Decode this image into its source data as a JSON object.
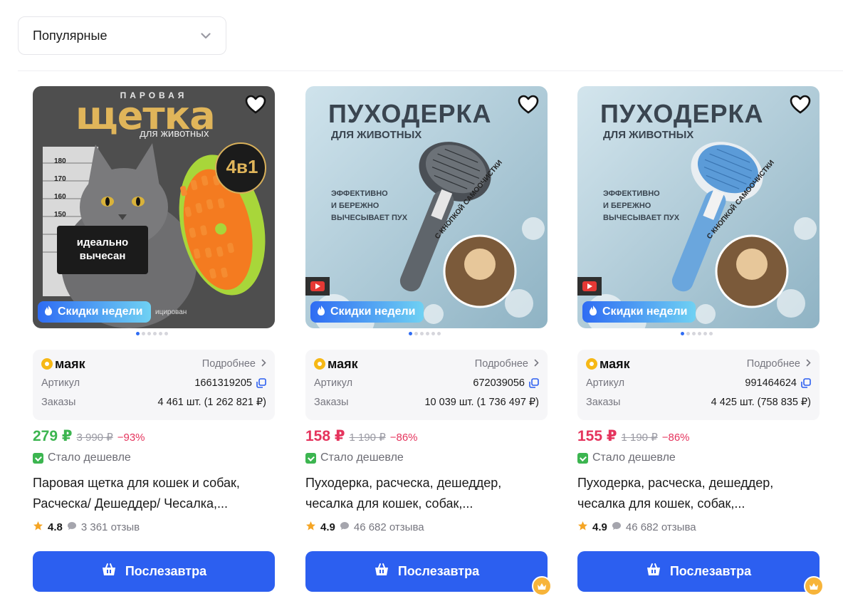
{
  "sort": {
    "label": "Популярные"
  },
  "colors": {
    "accent": "#2c5ff0",
    "green_price": "#3cb550",
    "red_price": "#e5345d"
  },
  "cards": [
    {
      "image": {
        "top_text": "ПАРОВАЯ",
        "headline": "щетка",
        "sub": "для животных",
        "badge_4in1": "4в1",
        "scale": [
          "180",
          "170",
          "160",
          "150"
        ],
        "plate": "идеально вычесан",
        "tail": "ицирован"
      },
      "promo": "Скидки недели",
      "brand": "маяк",
      "more": "Подробнее",
      "article_label": "Артикул",
      "article": "1661319205",
      "orders_label": "Заказы",
      "orders": "4 461 шт. (1 262 821 ₽)",
      "price": "279 ₽",
      "old_price": "3 990 ₽",
      "discount": "−93%",
      "cheaper": "Стало дешевле",
      "title_line1": "Паровая щетка для кошек и собак,",
      "title_line2": "Расческа/ Дешеддер/ Чесалка,...",
      "rating": "4.8",
      "reviews": "3 361 отзыв",
      "button": "Послезавтра"
    },
    {
      "image": {
        "headline": "ПУХОДЕРКА",
        "sub": "ДЛЯ ЖИВОТНЫХ",
        "desc1": "ЭФФЕКТИВНО",
        "desc2": "И БЕРЕЖНО",
        "desc3": "ВЫЧЕСЫВАЕТ ПУХ",
        "circle": "С КНОПКОЙ САМООЧИСТКИ"
      },
      "promo": "Скидки недели",
      "brand": "маяк",
      "more": "Подробнее",
      "article_label": "Артикул",
      "article": "672039056",
      "orders_label": "Заказы",
      "orders": "10 039 шт. (1 736 497 ₽)",
      "price": "158 ₽",
      "old_price": "1 190 ₽",
      "discount": "−86%",
      "cheaper": "Стало дешевле",
      "title_line1": "Пуходерка, расческа, дешеддер,",
      "title_line2": "чесалка для кошек, собак,...",
      "rating": "4.9",
      "reviews": "46 682 отзыва",
      "button": "Послезавтра"
    },
    {
      "image": {
        "headline": "ПУХОДЕРКА",
        "sub": "ДЛЯ ЖИВОТНЫХ",
        "desc1": "ЭФФЕКТИВНО",
        "desc2": "И БЕРЕЖНО",
        "desc3": "ВЫЧЕСЫВАЕТ ПУХ",
        "circle": "С КНОПКОЙ САМООЧИСТКИ"
      },
      "promo": "Скидки недели",
      "brand": "маяк",
      "more": "Подробнее",
      "article_label": "Артикул",
      "article": "991464624",
      "orders_label": "Заказы",
      "orders": "4 425 шт. (758 835 ₽)",
      "price": "155 ₽",
      "old_price": "1 190 ₽",
      "discount": "−86%",
      "cheaper": "Стало дешевле",
      "title_line1": "Пуходерка, расческа, дешеддер,",
      "title_line2": "чесалка для кошек, собак,...",
      "rating": "4.9",
      "reviews": "46 682 отзыва",
      "button": "Послезавтра"
    }
  ]
}
